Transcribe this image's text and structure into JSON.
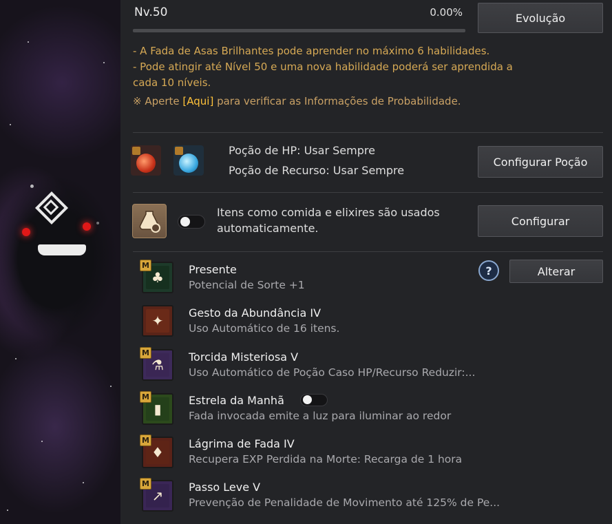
{
  "header": {
    "level": "Nv.50",
    "progress_text": "0.00%",
    "progress": 0.0,
    "evolve_label": "Evolução"
  },
  "info": {
    "lines": [
      "- A Fada de Asas Brilhantes pode aprender no máximo 6 habilidades.",
      "- Pode atingir até Nível 50 e uma nova habilidade poderá ser aprendida a",
      "cada 10 níveis."
    ],
    "note_prefix": "※ Aperte ",
    "note_link": "[Aqui]",
    "note_suffix": " para verificar as Informações de Probabilidade."
  },
  "potions": {
    "hp_text": "Poção de HP: Usar Sempre",
    "resource_text": "Poção de Recurso: Usar Sempre",
    "configure_label": "Configurar Poção",
    "hp_icon": "red-potion-icon",
    "resource_icon": "blue-potion-icon"
  },
  "auto_use": {
    "text_line1": "Itens como comida e elixires são usados",
    "text_line2": "automaticamente.",
    "enabled": false,
    "configure_label": "Configurar",
    "icon": "flask-gear-icon"
  },
  "skills_header": {
    "change_label": "Alterar",
    "help_symbol": "?"
  },
  "skills": [
    {
      "name": "Presente",
      "desc": "Potencial de Sorte +1",
      "badge": "M",
      "icon": "clover-icon",
      "color": "#1d3a2a"
    },
    {
      "name": "Gesto da Abundância IV",
      "desc": "Uso Automático de 16 itens.",
      "badge": "",
      "icon": "fairy-icon",
      "color": "#5a2418"
    },
    {
      "name": "Torcida Misteriosa V",
      "desc": "Uso Automático de Poção Caso HP/Recurso Reduzir:...",
      "badge": "M",
      "icon": "potion-swap-icon",
      "color": "#3d2a5a"
    },
    {
      "name": "Estrela da Manhã",
      "desc": "Fada invocada emite a luz para iluminar ao redor",
      "badge": "M",
      "icon": "lantern-icon",
      "color": "#2c4a1c",
      "toggle": false
    },
    {
      "name": "Lágrima de Fada IV",
      "desc": "Recupera EXP Perdida na Morte: Recarga de 1 hora",
      "badge": "M",
      "icon": "tear-vial-icon",
      "color": "#5a2218"
    },
    {
      "name": "Passo Leve V",
      "desc": "Prevenção de Penalidade de Movimento até 125% de Pe...",
      "badge": "M",
      "icon": "weight-arrow-icon",
      "color": "#3a2656"
    }
  ]
}
